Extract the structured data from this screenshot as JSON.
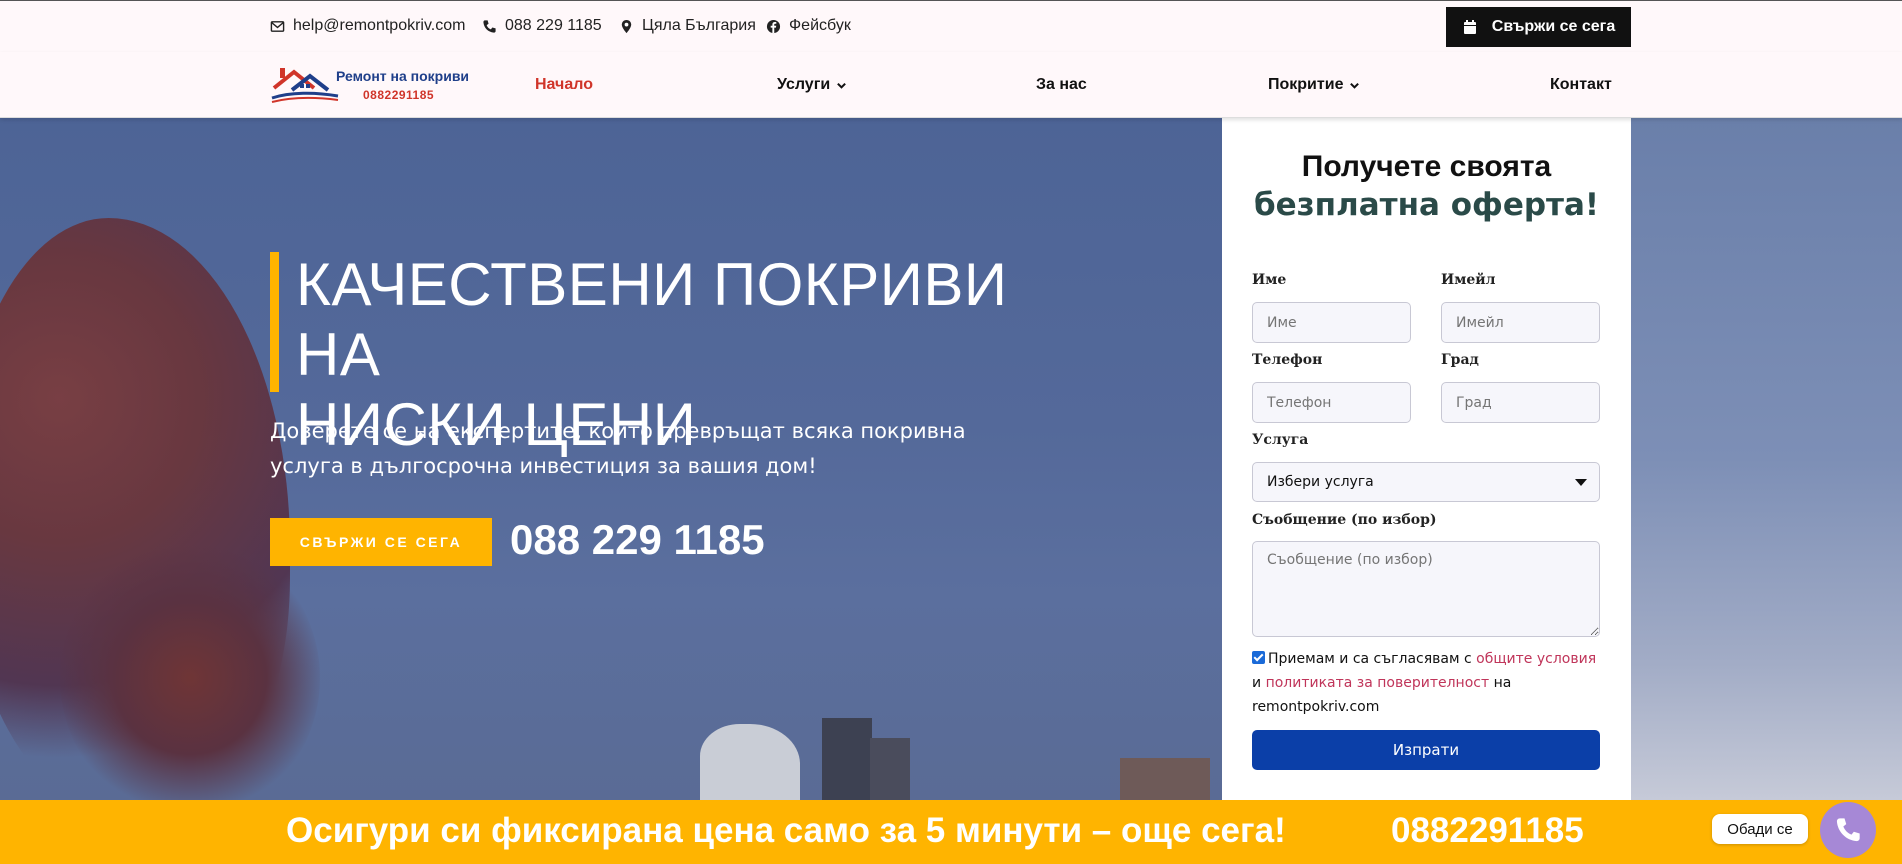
{
  "topbar": {
    "email": "help@remontpokriv.com",
    "phone": "088 229 1185",
    "location": "Цяла България",
    "facebook": "Фейсбук",
    "cta_label": "Свържи се сега"
  },
  "logo": {
    "title": "Ремонт на покриви",
    "phone": "0882291185"
  },
  "nav": {
    "items": [
      {
        "label": "Начало",
        "active": true,
        "dropdown": false
      },
      {
        "label": "Услуги",
        "active": false,
        "dropdown": true
      },
      {
        "label": "За нас",
        "active": false,
        "dropdown": false
      },
      {
        "label": "Покритие",
        "active": false,
        "dropdown": true
      },
      {
        "label": "Контакт",
        "active": false,
        "dropdown": false
      }
    ]
  },
  "hero": {
    "title_line1": "КАЧЕСТВЕНИ ПОКРИВИ НА",
    "title_line2": "НИСКИ ЦЕНИ",
    "subtitle": "Доверете се на експертите, които превръщат всяка покривна услуга в дългосрочна инвестиция за вашия дом!",
    "button_label": "СВЪРЖИ СЕ СЕГА",
    "phone": "088 229 1185"
  },
  "form": {
    "title_line1": "Получете своята",
    "title_line2": "безплатна оферта!",
    "name_label": "Име",
    "name_placeholder": "Име",
    "email_label": "Имейл",
    "email_placeholder": "Имейл",
    "phone_label": "Телефон",
    "phone_placeholder": "Телефон",
    "city_label": "Град",
    "city_placeholder": "Град",
    "service_label": "Услуга",
    "service_selected": "Избери услуга",
    "message_label": "Съобщение (по избор)",
    "message_placeholder": "Съобщение (по избор)",
    "consent_prefix": "Приемам и са съгласявам с",
    "consent_terms": "общите условия",
    "consent_and": "и",
    "consent_privacy": "политиката за поверителност",
    "consent_on": "на",
    "consent_site": "remontpokriv.com",
    "consent_checked": true,
    "submit_label": "Изпрати"
  },
  "banner": {
    "text": "Осигури си фиксирана цена само за 5 минути – още сега!",
    "phone": "0882291185"
  },
  "call_widget": {
    "label": "Обади се"
  },
  "colors": {
    "accent": "#ffb400",
    "nav_active": "#d0352a",
    "submit": "#0b3fa8",
    "link": "#c0355a",
    "call_button": "#a688d6"
  }
}
